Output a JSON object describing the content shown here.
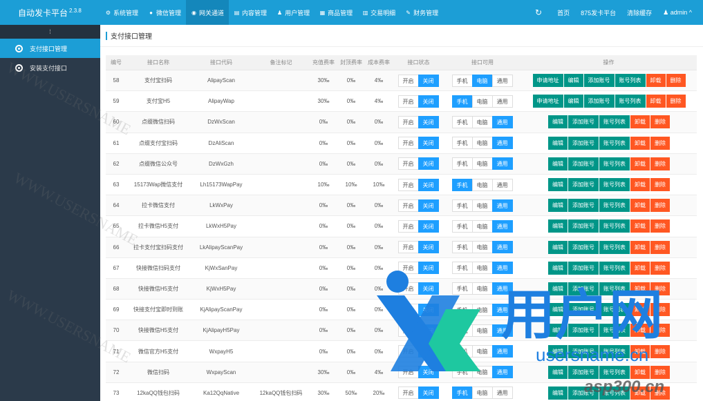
{
  "brand": {
    "name": "自动发卡平台",
    "version": "2.3.8"
  },
  "topnav": [
    {
      "label": "系统管理",
      "icon": "gear-icon",
      "glyph": "⚙"
    },
    {
      "label": "微信管理",
      "icon": "wechat-icon",
      "glyph": "●"
    },
    {
      "label": "网关通道",
      "icon": "gateway-icon",
      "glyph": "◉"
    },
    {
      "label": "内容管理",
      "icon": "document-icon",
      "glyph": "▤"
    },
    {
      "label": "用户管理",
      "icon": "users-icon",
      "glyph": "♟"
    },
    {
      "label": "商品管理",
      "icon": "goods-icon",
      "glyph": "▦"
    },
    {
      "label": "交易明细",
      "icon": "chart-icon",
      "glyph": "▥"
    },
    {
      "label": "财务管理",
      "icon": "finance-icon",
      "glyph": "✎"
    }
  ],
  "topright": {
    "home": "首页",
    "platform": "875发卡平台",
    "clear_cache": "清除缓存",
    "user": "admin"
  },
  "sidebar": {
    "toggle": "⁞",
    "items": [
      {
        "label": "支付接口管理"
      },
      {
        "label": "安装支付接口"
      }
    ]
  },
  "page_title": "支付接口管理",
  "columns": {
    "id": "编号",
    "name": "接口名称",
    "code": "接口代码",
    "remark": "备注标记",
    "rate": "充值费率",
    "top": "封顶费率",
    "cost": "成本费率",
    "status": "接口状态",
    "avail": "接口可用",
    "ops": "操作"
  },
  "labels": {
    "on": "开启",
    "off": "关闭",
    "mobile": "手机",
    "pc": "电脑",
    "all": "通用",
    "apply": "申请地址",
    "edit": "编辑",
    "add": "添加账号",
    "list": "账号列表",
    "uninstall": "卸载",
    "delete": "删除"
  },
  "rows": [
    {
      "id": "58",
      "name": "支付宝扫码",
      "code": "AlipayScan",
      "remark": "",
      "rate": "30‰",
      "top": "0‰",
      "cost": "4‰",
      "status_on": false,
      "avail": "pc",
      "apply": true
    },
    {
      "id": "59",
      "name": "支付宝H5",
      "code": "AlipayWap",
      "remark": "",
      "rate": "30‰",
      "top": "0‰",
      "cost": "4‰",
      "status_on": false,
      "avail": "mobile",
      "apply": true
    },
    {
      "id": "60",
      "name": "点缀微信扫码",
      "code": "DzWxScan",
      "remark": "",
      "rate": "0‰",
      "top": "0‰",
      "cost": "0‰",
      "status_on": false,
      "avail": "all",
      "apply": false
    },
    {
      "id": "61",
      "name": "点缀支付宝扫码",
      "code": "DzAliScan",
      "remark": "",
      "rate": "0‰",
      "top": "0‰",
      "cost": "0‰",
      "status_on": false,
      "avail": "all",
      "apply": false
    },
    {
      "id": "62",
      "name": "点缀微信公众号",
      "code": "DzWxGzh",
      "remark": "",
      "rate": "0‰",
      "top": "0‰",
      "cost": "0‰",
      "status_on": false,
      "avail": "all",
      "apply": false
    },
    {
      "id": "63",
      "name": "15173Wap微信支付",
      "code": "Lh15173WapPay",
      "remark": "",
      "rate": "10‰",
      "top": "10‰",
      "cost": "10‰",
      "status_on": false,
      "avail": "mobile",
      "apply": false
    },
    {
      "id": "64",
      "name": "拉卡微信支付",
      "code": "LkWxPay",
      "remark": "",
      "rate": "0‰",
      "top": "0‰",
      "cost": "0‰",
      "status_on": false,
      "avail": "all",
      "apply": false
    },
    {
      "id": "65",
      "name": "拉卡微信H5支付",
      "code": "LkWxH5Pay",
      "remark": "",
      "rate": "0‰",
      "top": "0‰",
      "cost": "0‰",
      "status_on": false,
      "avail": "all",
      "apply": false
    },
    {
      "id": "66",
      "name": "拉卡支付宝扫码支付",
      "code": "LkAlipayScanPay",
      "remark": "",
      "rate": "0‰",
      "top": "0‰",
      "cost": "0‰",
      "status_on": false,
      "avail": "all",
      "apply": false
    },
    {
      "id": "67",
      "name": "快接微信扫码支付",
      "code": "KjWxSanPay",
      "remark": "",
      "rate": "0‰",
      "top": "0‰",
      "cost": "0‰",
      "status_on": false,
      "avail": "all",
      "apply": false
    },
    {
      "id": "68",
      "name": "快接微信H5支付",
      "code": "KjWxH5Pay",
      "remark": "",
      "rate": "0‰",
      "top": "0‰",
      "cost": "0‰",
      "status_on": false,
      "avail": "all",
      "apply": false
    },
    {
      "id": "69",
      "name": "快接支付宝即时到账",
      "code": "KjAlipayScanPay",
      "remark": "",
      "rate": "0‰",
      "top": "0‰",
      "cost": "0‰",
      "status_on": false,
      "avail": "all",
      "apply": false
    },
    {
      "id": "70",
      "name": "快接微信H5支付",
      "code": "KjAlipayH5Pay",
      "remark": "",
      "rate": "0‰",
      "top": "0‰",
      "cost": "0‰",
      "status_on": false,
      "avail": "all",
      "apply": false
    },
    {
      "id": "71",
      "name": "微信官方H5支付",
      "code": "WxpayH5",
      "remark": "",
      "rate": "0‰",
      "top": "0‰",
      "cost": "0‰",
      "status_on": false,
      "avail": "all",
      "apply": false
    },
    {
      "id": "72",
      "name": "微信扫码",
      "code": "WxpayScan",
      "remark": "",
      "rate": "30‰",
      "top": "0‰",
      "cost": "4‰",
      "status_on": false,
      "avail": "all",
      "apply": false
    },
    {
      "id": "73",
      "name": "12kaQQ钱包扫码",
      "code": "Ka12QqNative",
      "remark": "12kaQQ钱包扫码",
      "rate": "30‰",
      "top": "50‰",
      "cost": "20‰",
      "status_on": false,
      "avail": "mobile",
      "apply": false
    }
  ],
  "watermark": {
    "text": "WWW.USERSNAME",
    "logo_text": "用户网",
    "url": "usersname.cn",
    "url2": "asp300.cn"
  },
  "colors": {
    "accent": "#1c9ed6",
    "button_blue": "#1e9fff",
    "green": "#009688",
    "orange": "#ff5722",
    "sidebar": "#2b3a4a"
  }
}
